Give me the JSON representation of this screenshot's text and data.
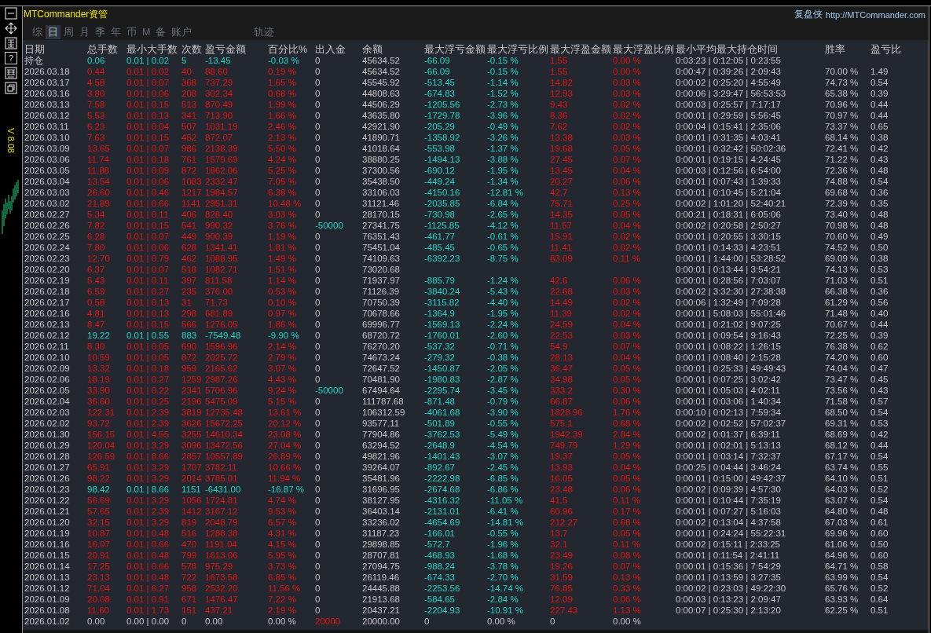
{
  "version": "V 8.08",
  "help_button": "?",
  "title": "MTCommander资管",
  "brand": {
    "name": "复盘侠",
    "url": "http://MTCommander.com"
  },
  "tabs": [
    {
      "label": "综",
      "selected": false
    },
    {
      "label": "日",
      "selected": true
    },
    {
      "label": "周",
      "selected": false
    },
    {
      "label": "月",
      "selected": false
    },
    {
      "label": "季",
      "selected": false
    },
    {
      "label": "年",
      "selected": false
    },
    {
      "label": "币",
      "selected": false
    },
    {
      "label": "M",
      "selected": false
    },
    {
      "label": "备",
      "selected": false
    },
    {
      "label": "账户",
      "selected": false
    }
  ],
  "track_tab": {
    "label": "轨迹",
    "selected": false
  },
  "table": {
    "columns": [
      "日期",
      "总手数",
      "最小大手数",
      "次数",
      "盈亏金额",
      "百分比%",
      "出入金",
      "余额",
      "最大浮亏金额",
      "最大浮亏比例",
      "最大浮盈金额",
      "最大浮盈比例",
      "最小平均最大持仓时间",
      "胜率",
      "盈亏比"
    ],
    "rows": [
      {
        "kind": "loss",
        "cells": [
          "持仓",
          "0.06",
          "0.01 | 0.02",
          "5",
          "-13.45",
          "-0.03 %",
          "0",
          "45634.52",
          "-66.09",
          "-0.15 %",
          "1.55",
          "0.00 %",
          "0:03:23 | 0:12:05 | 0:23:55",
          null,
          null
        ]
      },
      {
        "kind": "gain",
        "cells": [
          "2026.03.18",
          "0.44",
          "0.01 | 0.02",
          "40",
          "88.60",
          "0.19 %",
          "0",
          "45634.52",
          "-66.09",
          "-0.15 %",
          "1.55",
          "0.00 %",
          "0:00:47 | 0:39:26 | 2:09:43",
          "70.00 %",
          "1.49"
        ]
      },
      {
        "kind": "gain",
        "cells": [
          "2026.03.17",
          "4.58",
          "0.01 | 0.07",
          "368",
          "737.29",
          "1.65 %",
          "0",
          "45545.92",
          "-513.45",
          "-1.14 %",
          "14.82",
          "0.03 %",
          "0:00:02 | 0:25:20 | 4:55:49",
          "74.73 %",
          "0.54"
        ]
      },
      {
        "kind": "gain",
        "cells": [
          "2026.03.16",
          "3.80",
          "0.01 | 0.06",
          "208",
          "302.34",
          "0.68 %",
          "0",
          "44808.63",
          "-674.83",
          "-1.52 %",
          "12.93",
          "0.03 %",
          "0:00:06 | 3:29:47 | 56:53:53",
          "65.38 %",
          "0.39"
        ]
      },
      {
        "kind": "gain",
        "cells": [
          "2026.03.13",
          "7.58",
          "0.01 | 0.15",
          "513",
          "870.49",
          "1.99 %",
          "0",
          "44506.29",
          "-1205.56",
          "-2.73 %",
          "9.43",
          "0.02 %",
          "0:00:03 | 0:25:57 | 7:17:17",
          "70.96 %",
          "0.44"
        ]
      },
      {
        "kind": "gain",
        "cells": [
          "2026.03.12",
          "5.53",
          "0.01 | 0.13",
          "341",
          "713.90",
          "1.66 %",
          "0",
          "43635.80",
          "-1729.78",
          "-3.96 %",
          "8.36",
          "0.02 %",
          "0:00:01 | 0:29:59 | 5:56:45",
          "70.97 %",
          "0.44"
        ]
      },
      {
        "kind": "gain",
        "cells": [
          "2026.03.11",
          "6.23",
          "0.01 | 0.04",
          "507",
          "1031.19",
          "2.46 %",
          "0",
          "42921.90",
          "-205.29",
          "-0.49 %",
          "7.62",
          "0.02 %",
          "0:00:04 | 0:15:41 | 2:35:06",
          "73.37 %",
          "0.65"
        ]
      },
      {
        "kind": "gain",
        "cells": [
          "2026.03.10",
          "7.63",
          "0.01 | 0.15",
          "452",
          "872.07",
          "2.13 %",
          "0",
          "41890.71",
          "-1358.92",
          "-3.26 %",
          "13.38",
          "0.03 %",
          "0:00:01 | 0:31:35 | 4:03:41",
          "68.14 %",
          "0.38"
        ]
      },
      {
        "kind": "gain",
        "cells": [
          "2026.03.09",
          "13.65",
          "0.01 | 0.07",
          "986",
          "2138.39",
          "5.50 %",
          "0",
          "41018.64",
          "-553.98",
          "-1.37 %",
          "19.68",
          "0.05 %",
          "0:00:01 | 0:32:42 | 50:02:36",
          "72.41 %",
          "0.42"
        ]
      },
      {
        "kind": "gain",
        "cells": [
          "2026.03.06",
          "11.74",
          "0.01 | 0.18",
          "761",
          "1579.69",
          "4.24 %",
          "0",
          "38880.25",
          "-1494.13",
          "-3.88 %",
          "27.45",
          "0.07 %",
          "0:00:01 | 0:19:15 | 4:24:45",
          "71.22 %",
          "0.43"
        ]
      },
      {
        "kind": "gain",
        "cells": [
          "2026.03.05",
          "11.88",
          "0.01 | 0.09",
          "872",
          "1862.06",
          "5.25 %",
          "0",
          "37300.56",
          "-690.12",
          "-1.95 %",
          "13.45",
          "0.04 %",
          "0:00:03 | 0:12:56 | 6:54:00",
          "72.36 %",
          "0.48"
        ]
      },
      {
        "kind": "gain",
        "cells": [
          "2026.03.04",
          "13.54",
          "0.01 | 0.06",
          "1083",
          "2332.47",
          "7.05 %",
          "0",
          "35438.50",
          "-449.24",
          "-1.34 %",
          "20.27",
          "0.06 %",
          "0:00:01 | 0:07:43 | 1:39:33",
          "74.88 %",
          "0.54"
        ]
      },
      {
        "kind": "gain",
        "cells": [
          "2026.03.03",
          "26.60",
          "0.01 | 0.46",
          "1217",
          "1984.57",
          "6.38 %",
          "0",
          "33106.03",
          "-4150.16",
          "-12.81 %",
          "42.7",
          "0.13 %",
          "0:00:01 | 0:10:45 | 5:21:04",
          "69.68 %",
          "0.36"
        ]
      },
      {
        "kind": "gain",
        "cells": [
          "2026.03.02",
          "21.89",
          "0.01 | 0.66",
          "1141",
          "2951.31",
          "10.48 %",
          "0",
          "31121.46",
          "-2035.85",
          "-6.84 %",
          "75.71",
          "0.25 %",
          "0:00:02 | 1:01:20 | 52:40:21",
          "72.39 %",
          "0.35"
        ]
      },
      {
        "kind": "gain",
        "cells": [
          "2026.02.27",
          "5.34",
          "0.01 | 0.11",
          "406",
          "828.40",
          "3.03 %",
          "0",
          "28170.15",
          "-730.98",
          "-2.65 %",
          "14.35",
          "0.05 %",
          "0:00:21 | 0:18:31 | 6:05:06",
          "73.40 %",
          "0.48"
        ]
      },
      {
        "kind": "withdrawal",
        "cells": [
          "2026.02.26",
          "7.82",
          "0.01 | 0.15",
          "541",
          "990.32",
          "3.76 %",
          "-50000",
          "27341.75",
          "-1125.85",
          "-4.12 %",
          "11.57",
          "0.04 %",
          "0:00:02 | 0:20:58 | 2:50:27",
          "70.98 %",
          "0.48"
        ]
      },
      {
        "kind": "gain",
        "cells": [
          "2026.02.25",
          "6.28",
          "0.01 | 0.07",
          "449",
          "900.39",
          "1.19 %",
          "0",
          "76351.43",
          "-461.77",
          "-0.61 %",
          "15.91",
          "0.02 %",
          "0:00:01 | 0:20:55 | 3:30:15",
          "70.60 %",
          "0.49"
        ]
      },
      {
        "kind": "gain",
        "cells": [
          "2026.02.24",
          "7.80",
          "0.01 | 0.06",
          "628",
          "1341.41",
          "1.81 %",
          "0",
          "75451.04",
          "-485.45",
          "-0.65 %",
          "11.41",
          "0.02 %",
          "0:00:01 | 0:14:33 | 4:23:51",
          "74.52 %",
          "0.50"
        ]
      },
      {
        "kind": "gain",
        "cells": [
          "2026.02.23",
          "12.70",
          "0.01 | 0.79",
          "462",
          "1088.95",
          "1.49 %",
          "0",
          "74109.63",
          "-6392.23",
          "-8.75 %",
          "83.09",
          "0.11 %",
          "0:00:01 | 1:44:00 | 53:28:52",
          "69.09 %",
          "0.38"
        ]
      },
      {
        "kind": "gain",
        "cells": [
          "2026.02.20",
          "6.37",
          "0.01 | 0.07",
          "518",
          "1082.71",
          "1.51 %",
          "0",
          "73020.68",
          null,
          null,
          null,
          null,
          "0:00:01 | 0:13:44 | 3:54:21",
          "74.13 %",
          "0.53"
        ]
      },
      {
        "kind": "gain",
        "cells": [
          "2026.02.19",
          "5.43",
          "0.01 | 0.11",
          "397",
          "811.58",
          "1.14 %",
          "0",
          "71937.97",
          "-885.79",
          "-1.24 %",
          "42.6",
          "0.06 %",
          "0:00:01 | 0:28:56 | 7:03:07",
          "71.03 %",
          "0.51"
        ]
      },
      {
        "kind": "gain",
        "cells": [
          "2026.02.18",
          "6.59",
          "0.01 | 0.27",
          "235",
          "376.00",
          "0.53 %",
          "0",
          "71126.39",
          "-3840.24",
          "-5.43 %",
          "22.68",
          "0.03 %",
          "0:00:02 | 3:32:30 | 27:38:38",
          "66.38 %",
          "0.36"
        ]
      },
      {
        "kind": "gain",
        "cells": [
          "2026.02.17",
          "0.58",
          "0.01 | 0.13",
          "31",
          "71.73",
          "0.10 %",
          "0",
          "70750.39",
          "-3115.82",
          "-4.40 %",
          "14.49",
          "0.02 %",
          "0:00:06 | 1:32:49 | 7:09:28",
          "61.29 %",
          "0.56"
        ]
      },
      {
        "kind": "gain",
        "cells": [
          "2026.02.16",
          "4.81",
          "0.01 | 0.13",
          "298",
          "681.89",
          "0.97 %",
          "0",
          "70678.66",
          "-1364.9",
          "-1.95 %",
          "11.39",
          "0.02 %",
          "0:00:01 | 5:08:03 | 55:01:46",
          "71.48 %",
          "0.40"
        ]
      },
      {
        "kind": "gain",
        "cells": [
          "2026.02.13",
          "8.47",
          "0.01 | 0.15",
          "566",
          "1276.05",
          "1.86 %",
          "0",
          "69996.77",
          "-1569.13",
          "-2.24 %",
          "24.59",
          "0.04 %",
          "0:00:01 | 0:21:02 | 9:07:25",
          "70.67 %",
          "0.44"
        ]
      },
      {
        "kind": "loss",
        "cells": [
          "2026.02.12",
          "19.22",
          "0.01 | 0.55",
          "883",
          "-7549.48",
          "-9.90 %",
          "0",
          "68720.72",
          "-1760.01",
          "-2.60 %",
          "22.53",
          "0.03 %",
          "0:00:01 | 0:09:54 | 9:16:43",
          "72.25 %",
          "0.39"
        ]
      },
      {
        "kind": "gain",
        "cells": [
          "2026.02.11",
          "8.30",
          "0.01 | 0.05",
          "690",
          "1596.96",
          "2.14 %",
          "0",
          "76270.20",
          "-537.32",
          "-0.71 %",
          "54.9",
          "0.07 %",
          "0:00:01 | 0:08:22 | 1:26:15",
          "76.38 %",
          "0.62"
        ]
      },
      {
        "kind": "gain",
        "cells": [
          "2026.02.10",
          "10.59",
          "0.01 | 0.05",
          "872",
          "2025.72",
          "2.79 %",
          "0",
          "74673.24",
          "-279.32",
          "-0.38 %",
          "28.13",
          "0.04 %",
          "0:00:01 | 0:08:40 | 2:15:28",
          "74.20 %",
          "0.60"
        ]
      },
      {
        "kind": "gain",
        "cells": [
          "2026.02.09",
          "13.32",
          "0.01 | 0.18",
          "959",
          "2165.62",
          "3.07 %",
          "0",
          "72647.52",
          "-1450.87",
          "-2.05 %",
          "36.47",
          "0.05 %",
          "0:00:01 | 0:25:33 | 49:49:43",
          "74.04 %",
          "0.47"
        ]
      },
      {
        "kind": "gain",
        "cells": [
          "2026.02.06",
          "18.19",
          "0.01 | 0.27",
          "1259",
          "2987.26",
          "4.43 %",
          "0",
          "70481.90",
          "-1980.83",
          "-2.87 %",
          "34.98",
          "0.05 %",
          "0:00:01 | 0:07:25 | 3:02:42",
          "73.47 %",
          "0.45"
        ]
      },
      {
        "kind": "withdrawal",
        "cells": [
          "2026.02.05",
          "33.90",
          "0.01 | 0.22",
          "2341",
          "5706.96",
          "9.24 %",
          "-50000",
          "67494.64",
          "-2295.74",
          "-3.45 %",
          "333.2",
          "0.30 %",
          "0:00:01 | 0:05:03 | 4:02:11",
          "73.56 %",
          "0.43"
        ]
      },
      {
        "kind": "gain",
        "cells": [
          "2026.02.04",
          "36.60",
          "0.01 | 0.25",
          "2196",
          "5475.09",
          "5.15 %",
          "0",
          "111787.68",
          "-871.48",
          "-0.79 %",
          "66.87",
          "0.06 %",
          "0:00:01 | 0:03:06 | 1:40:34",
          "71.58 %",
          "0.57"
        ]
      },
      {
        "kind": "gain",
        "cells": [
          "2026.02.03",
          "122.31",
          "0.01 | 2.39",
          "3819",
          "12735.48",
          "13.61 %",
          "0",
          "106312.59",
          "-4061.68",
          "-3.90 %",
          "1828.96",
          "1.76 %",
          "0:00:10 | 0:02:13 | 7:59:34",
          "68.50 %",
          "0.54"
        ]
      },
      {
        "kind": "gain",
        "cells": [
          "2026.02.02",
          "93.72",
          "0.01 | 2.39",
          "3626",
          "15672.25",
          "20.12 %",
          "0",
          "93577.11",
          "-501.89",
          "-0.55 %",
          "575.1",
          "0.68 %",
          "0:00:02 | 0:02:52 | 57:02:37",
          "69.31 %",
          "0.53"
        ]
      },
      {
        "kind": "gain",
        "cells": [
          "2026.01.30",
          "156.15",
          "0.01 | 4.55",
          "3255",
          "14610.34",
          "23.08 %",
          "0",
          "77904.86",
          "-3762.53",
          "-5.49 %",
          "1942.39",
          "2.84 %",
          "0:00:02 | 0:01:37 | 6:39:11",
          "68.69 %",
          "0.42"
        ]
      },
      {
        "kind": "gain",
        "cells": [
          "2026.01.29",
          "120.04",
          "0.01 | 3.29",
          "3096",
          "13472.56",
          "27.04 %",
          "0",
          "63294.52",
          "-2648.9",
          "-4.54 %",
          "749.79",
          "1.29 %",
          "0:00:01 | 0:02:01 | 5:13:13",
          "68.12 %",
          "0.44"
        ]
      },
      {
        "kind": "gain",
        "cells": [
          "2026.01.28",
          "126.59",
          "0.01 | 8.66",
          "2857",
          "10557.89",
          "26.89 %",
          "0",
          "49821.96",
          "-1401.43",
          "-3.07 %",
          "19.37",
          "0.05 %",
          "0:00:01 | 0:03:14 | 7:32:37",
          "67.17 %",
          "0.54"
        ]
      },
      {
        "kind": "gain",
        "cells": [
          "2026.01.27",
          "65.91",
          "0.01 | 3.29",
          "1707",
          "3782.11",
          "10.66 %",
          "0",
          "39264.07",
          "-892.67",
          "-2.45 %",
          "13.93",
          "0.04 %",
          "0:00:25 | 0:04:44 | 3:46:24",
          "63.74 %",
          "0.55"
        ]
      },
      {
        "kind": "gain",
        "cells": [
          "2026.01.26",
          "98.22",
          "0.01 | 3.29",
          "2014",
          "3785.01",
          "11.94 %",
          "0",
          "35481.96",
          "-2222.98",
          "-6.85 %",
          "16.05",
          "0.05 %",
          "0:00:01 | 0:15:00 | 49:42:37",
          "64.10 %",
          "0.51"
        ]
      },
      {
        "kind": "loss",
        "cells": [
          "2026.01.23",
          "98.42",
          "0.01 | 8.66",
          "1151",
          "-6431.00",
          "-16.87 %",
          "0",
          "31696.95",
          "-2674.68",
          "-6.86 %",
          "23.48",
          "0.06 %",
          "0:00:02 | 0:09:39 | 4:57:30",
          "64.03 %",
          "0.52"
        ]
      },
      {
        "kind": "gain",
        "cells": [
          "2026.01.22",
          "56.69",
          "0.01 | 3.29",
          "1056",
          "1724.81",
          "4.74 %",
          "0",
          "38127.95",
          "-4316.32",
          "-11.05 %",
          "41.5",
          "0.11 %",
          "0:00:01 | 0:10:44 | 7:35:19",
          "63.07 %",
          "0.54"
        ]
      },
      {
        "kind": "gain",
        "cells": [
          "2026.01.21",
          "57.65",
          "0.01 | 2.39",
          "1412",
          "3167.12",
          "9.53 %",
          "0",
          "36403.14",
          "-2131.01",
          "-6.41 %",
          "60.96",
          "0.17 %",
          "0:00:01 | 0:07:27 | 5:16:03",
          "64.80 %",
          "0.48"
        ]
      },
      {
        "kind": "gain",
        "cells": [
          "2026.01.20",
          "32.15",
          "0.01 | 3.29",
          "819",
          "2048.79",
          "6.57 %",
          "0",
          "33236.02",
          "-4654.69",
          "-14.81 %",
          "212.27",
          "0.68 %",
          "0:00:02 | 0:13:04 | 4:37:58",
          "67.03 %",
          "0.61"
        ]
      },
      {
        "kind": "gain",
        "cells": [
          "2026.01.19",
          "10.87",
          "0.01 | 0.48",
          "516",
          "1288.38",
          "4.31 %",
          "0",
          "31187.23",
          "-166.01",
          "-0.55 %",
          "13.7",
          "0.05 %",
          "0:00:01 | 0:24:24 | 55:22:31",
          "69.96 %",
          "0.60"
        ]
      },
      {
        "kind": "gain",
        "cells": [
          "2026.01.16",
          "16.07",
          "0.01 | 0.66",
          "470",
          "1191.04",
          "4.15 %",
          "0",
          "29898.85",
          "-572.7",
          "-1.96 %",
          "32.1",
          "0.11 %",
          "0:00:02 | 0:15:11 | 2:33:25",
          "61.06 %",
          "0.50"
        ]
      },
      {
        "kind": "gain",
        "cells": [
          "2026.01.15",
          "20.91",
          "0.01 | 0.48",
          "799",
          "1613.06",
          "5.95 %",
          "0",
          "28707.81",
          "-468.93",
          "-1.68 %",
          "23.49",
          "0.08 %",
          "0:00:01 | 0:11:54 | 2:41:11",
          "64.96 %",
          "0.60"
        ]
      },
      {
        "kind": "gain",
        "cells": [
          "2026.01.14",
          "17.25",
          "0.01 | 0.66",
          "578",
          "975.29",
          "3.73 %",
          "0",
          "27094.75",
          "-988.24",
          "-3.78 %",
          "19.26",
          "0.07 %",
          "0:00:01 | 0:15:36 | 7:54:29",
          "64.71 %",
          "0.58"
        ]
      },
      {
        "kind": "gain",
        "cells": [
          "2026.01.13",
          "23.13",
          "0.01 | 0.48",
          "722",
          "1673.58",
          "6.85 %",
          "0",
          "26119.46",
          "-674.33",
          "-2.70 %",
          "31.59",
          "0.13 %",
          "0:00:01 | 0:13:59 | 3:27:35",
          "63.99 %",
          "0.54"
        ]
      },
      {
        "kind": "gain",
        "cells": [
          "2026.01.12",
          "71.04",
          "0.01 | 6.27",
          "958",
          "2532.20",
          "11.56 %",
          "0",
          "24445.88",
          "-2253.56",
          "-14.74 %",
          "76.85",
          "0.33 %",
          "0:00:02 | 0:23:03 | 49:22:30",
          "65.76 %",
          "0.52"
        ]
      },
      {
        "kind": "gain",
        "cells": [
          "2026.01.09",
          "20.08",
          "0.01 | 0.91",
          "671",
          "1476.47",
          "7.22 %",
          "0",
          "21913.68",
          "-584.65",
          "-2.84 %",
          "12.09",
          "0.06 %",
          "0:00:03 | 0:13:23 | 2:09:47",
          "63.93 %",
          "0.64"
        ]
      },
      {
        "kind": "gain",
        "cells": [
          "2026.01.08",
          "11.60",
          "0.01 | 1.73",
          "151",
          "437.21",
          "2.19 %",
          "0",
          "20437.21",
          "-2204.93",
          "-10.91 %",
          "227.43",
          "1.13 %",
          "0:00:07 | 0:25:30 | 2:13:20",
          "62.25 %",
          "0.51"
        ]
      },
      {
        "kind": "deposit",
        "cells": [
          "2026.01.02",
          "0.00",
          "0.00 | 0.00",
          "0",
          "0.00",
          "0.00 %",
          "20000",
          "20000.00",
          "0",
          "0.00 %",
          "0",
          "0.00 %",
          null,
          null,
          null
        ]
      }
    ]
  }
}
